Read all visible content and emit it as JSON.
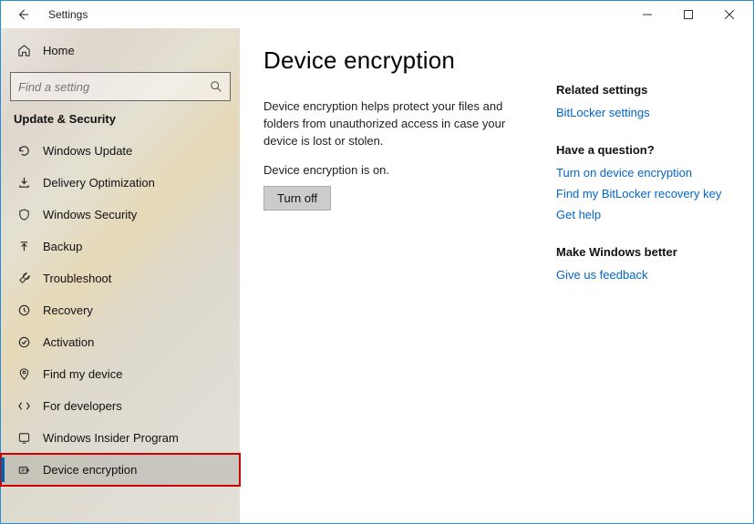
{
  "window": {
    "title": "Settings"
  },
  "home_label": "Home",
  "search": {
    "placeholder": "Find a setting"
  },
  "section": "Update & Security",
  "nav": [
    {
      "id": "windows-update",
      "label": "Windows Update"
    },
    {
      "id": "delivery-optimization",
      "label": "Delivery Optimization"
    },
    {
      "id": "windows-security",
      "label": "Windows Security"
    },
    {
      "id": "backup",
      "label": "Backup"
    },
    {
      "id": "troubleshoot",
      "label": "Troubleshoot"
    },
    {
      "id": "recovery",
      "label": "Recovery"
    },
    {
      "id": "activation",
      "label": "Activation"
    },
    {
      "id": "find-my-device",
      "label": "Find my device"
    },
    {
      "id": "for-developers",
      "label": "For developers"
    },
    {
      "id": "windows-insider-program",
      "label": "Windows Insider Program"
    },
    {
      "id": "device-encryption",
      "label": "Device encryption",
      "selected": true,
      "highlighted": true
    }
  ],
  "page": {
    "title": "Device encryption",
    "description": "Device encryption helps protect your files and folders from unauthorized access in case your device is lost or stolen.",
    "status": "Device encryption is on.",
    "button_label": "Turn off"
  },
  "aside": {
    "related": {
      "heading": "Related settings",
      "links": [
        "BitLocker settings"
      ]
    },
    "question": {
      "heading": "Have a question?",
      "links": [
        "Turn on device encryption",
        "Find my BitLocker recovery key",
        "Get help"
      ]
    },
    "feedback": {
      "heading": "Make Windows better",
      "links": [
        "Give us feedback"
      ]
    }
  }
}
